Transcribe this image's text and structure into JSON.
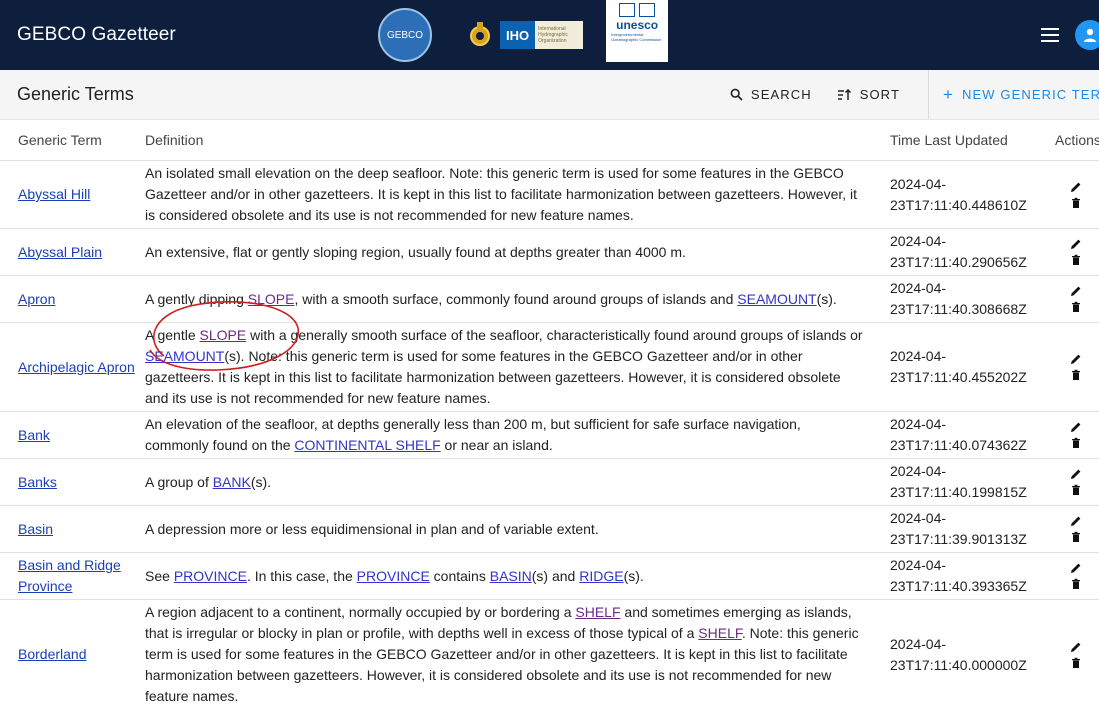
{
  "appbar": {
    "title": "GEBCO Gazetteer",
    "logos": {
      "gebco": "GEBCO",
      "iho": "IHO",
      "iho_sub": "International Hydrographic Organization",
      "unesco": "unesco",
      "unesco_sub": "Intergovernmental Oceanographic Commission"
    },
    "icons": [
      "menu-icon",
      "account-icon"
    ]
  },
  "toolbar": {
    "title": "Generic Terms",
    "search_label": "SEARCH",
    "sort_label": "SORT",
    "new_label": "NEW GENERIC TERM",
    "new_plus": "+"
  },
  "table": {
    "headers": {
      "term": "Generic Term",
      "definition": "Definition",
      "time": "Time Last Updated",
      "actions": "Actions"
    },
    "rows": [
      {
        "term": "Abyssal Hill",
        "def": [
          {
            "t": "An isolated small elevation on the deep seafloor. Note: this generic term is used for some features in the GEBCO Gazetteer and/or in other gazetteers. It is kept in this list to facilitate harmonization between gazetteers. However, it is considered obsolete and its use is not recommended for new feature names."
          }
        ],
        "time_a": "2024-04-",
        "time_b": "23T17:11:40.448610Z"
      },
      {
        "term": "Abyssal Plain",
        "def": [
          {
            "t": "An extensive, flat or gently sloping region, usually found at depths greater than 4000 m."
          }
        ],
        "time_a": "2024-04-",
        "time_b": "23T17:11:40.290656Z"
      },
      {
        "term": "Apron",
        "def": [
          {
            "t": "A gently dipping "
          },
          {
            "l": "SLOPE",
            "v": true
          },
          {
            "t": ", with a smooth surface, commonly found around groups of islands and "
          },
          {
            "l": "SEAMOUNT",
            "v": false
          },
          {
            "t": "(s)."
          }
        ],
        "time_a": "2024-04-",
        "time_b": "23T17:11:40.308668Z"
      },
      {
        "term": "Archipelagic Apron",
        "def": [
          {
            "t": "A gentle "
          },
          {
            "l": "SLOPE",
            "v": true
          },
          {
            "t": " with a generally smooth surface of the seafloor, characteristically found around groups of islands or "
          },
          {
            "l": "SEAMOUNT",
            "v": false
          },
          {
            "t": "(s). Note: this generic term is used for some features in the GEBCO Gazetteer and/or in other gazetteers. It is kept in this list to facilitate harmonization between gazetteers. However, it is considered obsolete and its use is not recommended for new feature names."
          }
        ],
        "time_a": "2024-04-",
        "time_b": "23T17:11:40.455202Z"
      },
      {
        "term": "Bank",
        "def": [
          {
            "t": "An elevation of the seafloor, at depths generally less than 200 m, but sufficient for safe surface navigation, commonly found on the "
          },
          {
            "l": "CONTINENTAL SHELF",
            "v": false
          },
          {
            "t": " or near an island."
          }
        ],
        "time_a": "2024-04-",
        "time_b": "23T17:11:40.074362Z"
      },
      {
        "term": "Banks",
        "def": [
          {
            "t": "A group of "
          },
          {
            "l": "BANK",
            "v": false
          },
          {
            "t": "(s)."
          }
        ],
        "time_a": "2024-04-",
        "time_b": "23T17:11:40.199815Z"
      },
      {
        "term": "Basin",
        "def": [
          {
            "t": "A depression more or less equidimensional in plan and of variable extent."
          }
        ],
        "time_a": "2024-04-",
        "time_b": "23T17:11:39.901313Z"
      },
      {
        "term": "Basin and Ridge Province",
        "def": [
          {
            "t": "See "
          },
          {
            "l": "PROVINCE",
            "v": false
          },
          {
            "t": ". In this case, the "
          },
          {
            "l": "PROVINCE",
            "v": false
          },
          {
            "t": " contains "
          },
          {
            "l": "BASIN",
            "v": false
          },
          {
            "t": "(s) and "
          },
          {
            "l": "RIDGE",
            "v": false
          },
          {
            "t": "(s)."
          }
        ],
        "time_a": "2024-04-",
        "time_b": "23T17:11:40.393365Z"
      },
      {
        "term": "Borderland",
        "def": [
          {
            "t": "A region adjacent to a continent, normally occupied by or bordering a "
          },
          {
            "l": "SHELF",
            "v": true
          },
          {
            "t": " and sometimes emerging as islands, that is irregular or blocky in plan or profile, with depths well in excess of those typical of a "
          },
          {
            "l": "SHELF",
            "v": true
          },
          {
            "t": ". Note: this generic term is used for some features in the GEBCO Gazetteer and/or in other gazetteers. It is kept in this list to facilitate harmonization between gazetteers. However, it is considered obsolete and its use is not recommended for new feature names."
          }
        ],
        "time_a": "2024-04-",
        "time_b": "23T17:11:40.000000Z"
      }
    ],
    "row_icons": [
      "edit-icon",
      "delete-icon"
    ]
  },
  "colors": {
    "appbar": "#0e1e3d",
    "toolbar": "#f5f5f5",
    "accent": "#1e88e5",
    "link": "#1a3fb6",
    "annotation": "#cc1f1f"
  }
}
